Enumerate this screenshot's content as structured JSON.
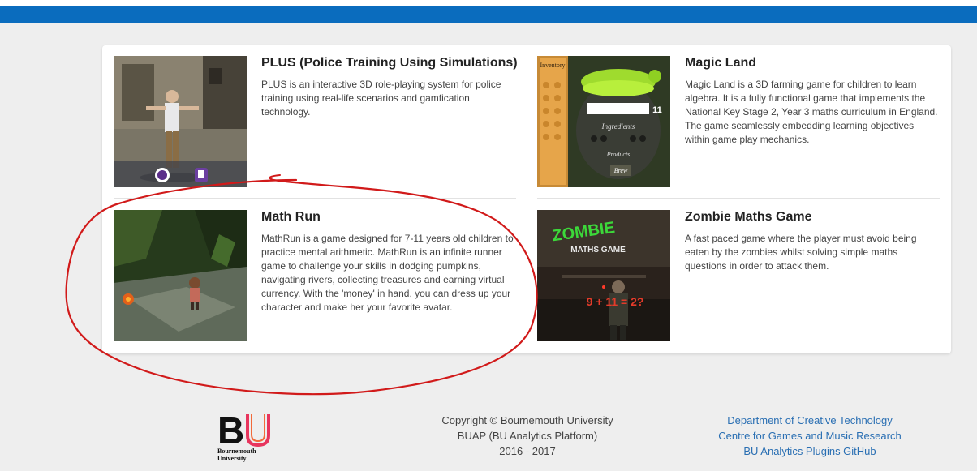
{
  "projects": [
    {
      "title": "PLUS (Police Training Using Simulations)",
      "description": "PLUS is an interactive 3D role-playing system for police training using real-life scenarios and gamfication technology."
    },
    {
      "title": "Magic Land",
      "description": "Magic Land is a 3D farming game for children to learn algebra. It is a fully functional game that implements the National Key Stage 2, Year 3 maths curriculum in England. The game seamlessly embedding learning objectives within game play mechanics.",
      "thumb_text": {
        "inventory": "Inventory",
        "ingredients": "Ingredients",
        "count": "11",
        "products": "Products",
        "brew": "Brew"
      }
    },
    {
      "title": "Math Run",
      "description": "MathRun is a game designed for 7-11 years old children to practice mental arithmetic. MathRun is an infinite runner game to challenge your skills in dodging pumpkins, navigating rivers, collecting treasures and earning virtual currency. With the 'money' in hand, you can dress up your character and make her your favorite avatar."
    },
    {
      "title": "Zombie Maths Game",
      "description": "A fast paced game where the player must avoid being eaten by the zombies whilst solving simple maths questions in order to attack them.",
      "thumb_text": {
        "logo_top": "ZOMBIE",
        "logo_bottom": "MATHS GAME",
        "equation": "9 + 11 = 2?"
      }
    }
  ],
  "footer": {
    "logo_letters": "BU",
    "logo_name_line1": "Bournemouth",
    "logo_name_line2": "University",
    "copyright": "Copyright © Bournemouth University",
    "platform": "BUAP (BU Analytics Platform)",
    "years": "2016 - 2017",
    "links": [
      "Department of Creative Technology",
      "Centre for Games and Music Research",
      "BU Analytics Plugins GitHub"
    ]
  },
  "colors": {
    "top_bar": "#0a6cbe",
    "link": "#2a6fb3",
    "annotation": "#d11a1a",
    "logo_u": "#e8355d"
  }
}
